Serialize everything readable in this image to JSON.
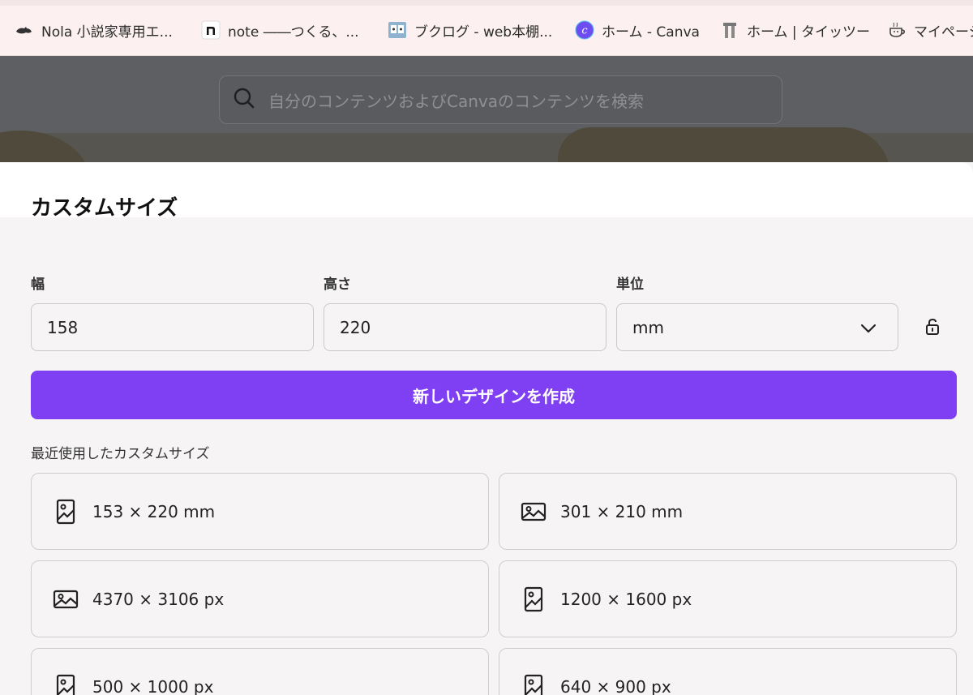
{
  "bookmarks": [
    {
      "icon": "cat-icon",
      "label": "Nola 小説家専用エ..."
    },
    {
      "icon": "note-icon",
      "label": "note ――つくる、..."
    },
    {
      "icon": "booklog-icon",
      "label": "ブクログ - web本棚..."
    },
    {
      "icon": "canva-icon",
      "label": "ホーム - Canva"
    },
    {
      "icon": "taittsu-icon",
      "label": "ホーム | タイッツー"
    },
    {
      "icon": "cup-icon",
      "label": "マイペーシ"
    }
  ],
  "search": {
    "placeholder": "自分のコンテンツおよびCanvaのコンテンツを検索"
  },
  "modal": {
    "title": "カスタムサイズ",
    "width_label": "幅",
    "width_value": "158",
    "height_label": "高さ",
    "height_value": "220",
    "unit_label": "単位",
    "unit_value": "mm",
    "create_button": "新しいデザインを作成",
    "recent_label": "最近使用したカスタムサイズ",
    "recent": [
      {
        "icon": "portrait-image-icon",
        "label": "153 × 220 mm"
      },
      {
        "icon": "landscape-image-icon",
        "label": "301 × 210 mm"
      },
      {
        "icon": "landscape-image-icon",
        "label": "4370 × 3106 px"
      },
      {
        "icon": "portrait-image-icon",
        "label": "1200 × 1600 px"
      },
      {
        "icon": "portrait-image-icon",
        "label": "500 × 1000 px"
      },
      {
        "icon": "portrait-image-icon",
        "label": "640 × 900 px"
      }
    ]
  },
  "colors": {
    "accent": "#7f3ff2",
    "canva_brand": "#6d4cf0"
  }
}
